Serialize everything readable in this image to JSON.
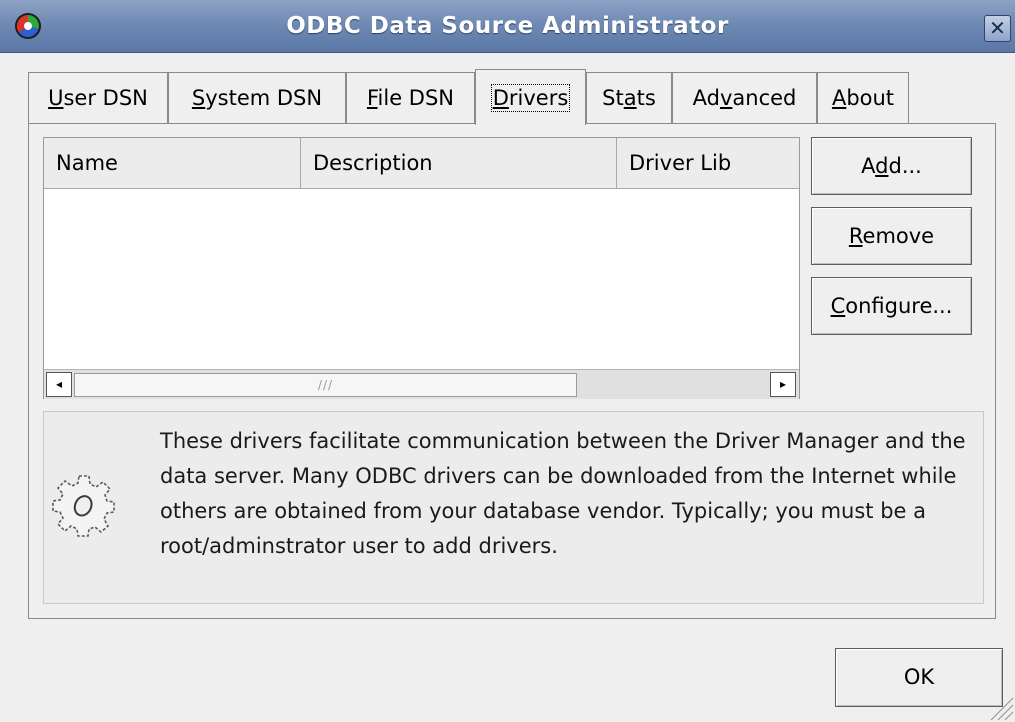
{
  "window": {
    "title": "ODBC Data Source Administrator",
    "close_glyph": "✕"
  },
  "tabs": [
    {
      "label": "User DSN",
      "accel": "U"
    },
    {
      "label": "System DSN",
      "accel": "S"
    },
    {
      "label": "File DSN",
      "accel": "F"
    },
    {
      "label": "Drivers",
      "accel": "D",
      "active": true
    },
    {
      "label": "Stats",
      "accel": "a"
    },
    {
      "label": "Advanced",
      "accel": "v"
    },
    {
      "label": "About",
      "accel": "A"
    }
  ],
  "drivers_list": {
    "columns": [
      "Name",
      "Description",
      "Driver Lib"
    ],
    "rows": [],
    "scroll_left_glyph": "◂",
    "scroll_right_glyph": "▸",
    "thumb_grip": "///"
  },
  "buttons": {
    "add": "Add...",
    "remove": "Remove",
    "configure": "Configure...",
    "ok": "OK"
  },
  "info": {
    "icon": "gear-icon",
    "text": "These drivers facilitate communication between the Driver Manager and the data server. Many ODBC drivers can be downloaded from the Internet while others are obtained from your database vendor. Typically; you must be a root/adminstrator user to add drivers."
  }
}
